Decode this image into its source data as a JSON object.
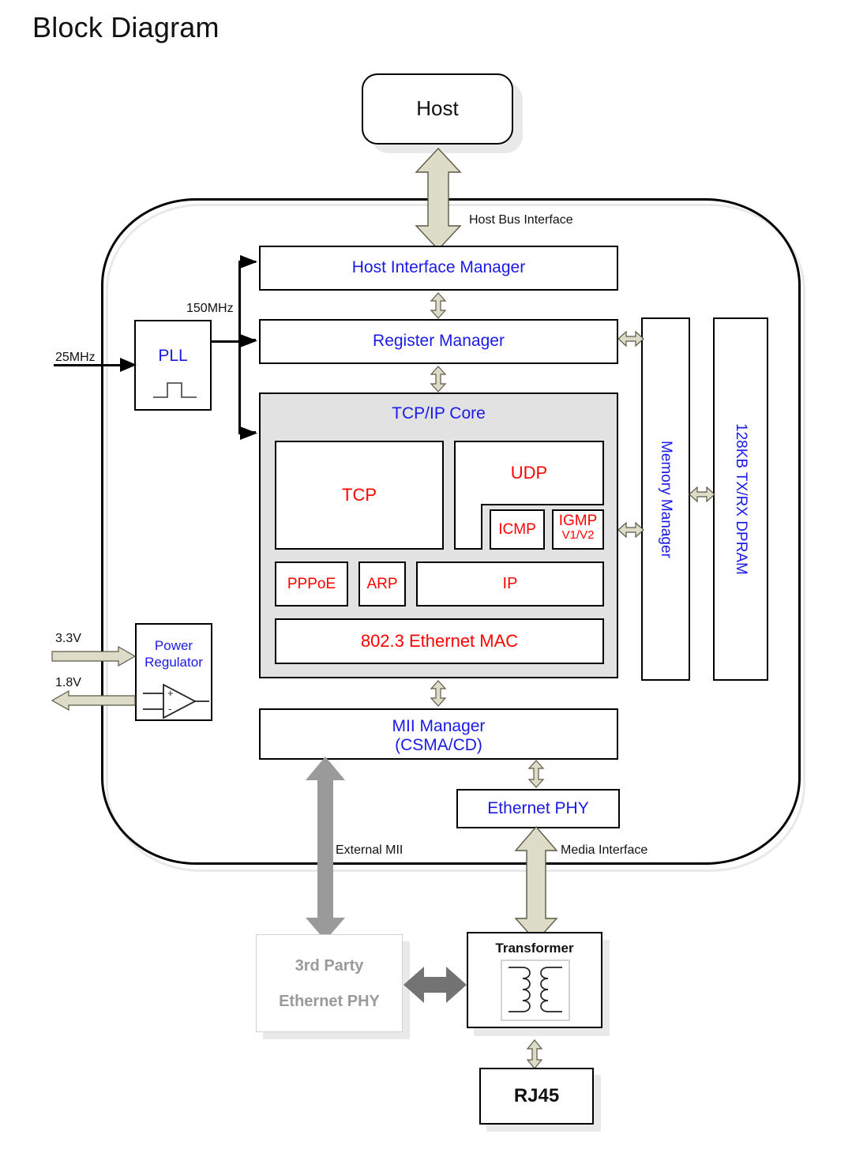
{
  "page": {
    "title": "Block Diagram"
  },
  "colors": {
    "block_label_blue": "#1a1ae6",
    "protocol_label_red": "#ff0000",
    "annotation_black": "#111111",
    "third_party_gray": "#9a9a9a",
    "arrow_sage": "#dcdcc8",
    "arrow_gray": "#9a9a9a",
    "core_fill_gray": "#e2e2e2",
    "shadow_gray": "#e9e9e9"
  },
  "external": {
    "host": "Host",
    "third_party_phy_line1": "3rd Party",
    "third_party_phy_line2": "Ethernet PHY",
    "transformer": "Transformer",
    "rj45": "RJ45"
  },
  "interfaces": {
    "host_bus": "Host Bus Interface",
    "external_mii": "External MII",
    "media": "Media Interface"
  },
  "clocks": {
    "input": "25MHz",
    "output": "150MHz",
    "pll": "PLL"
  },
  "power": {
    "vin": "3.3V",
    "vout": "1.8V",
    "regulator_line1": "Power",
    "regulator_line2": "Regulator"
  },
  "chip": {
    "host_interface_manager": "Host Interface Manager",
    "register_manager": "Register Manager",
    "memory_manager": "Memory Manager",
    "dpram": "128KB TX/RX DPRAM",
    "mii_manager_line1": "MII  Manager",
    "mii_manager_line2": "(CSMA/CD)",
    "ethernet_phy": "Ethernet PHY"
  },
  "core": {
    "title": "TCP/IP Core",
    "blocks": {
      "tcp": "TCP",
      "udp": "UDP",
      "icmp": "ICMP",
      "igmp": "IGMP",
      "igmp_version": "V1/V2",
      "pppoe": "PPPoE",
      "arp": "ARP",
      "ip": "IP",
      "mac": "802.3 Ethernet MAC"
    }
  },
  "icons": {
    "pll_waveform": "clock-pulse-icon",
    "opamp": "operational-amplifier-icon",
    "transformer_coils": "transformer-coil-icon"
  }
}
